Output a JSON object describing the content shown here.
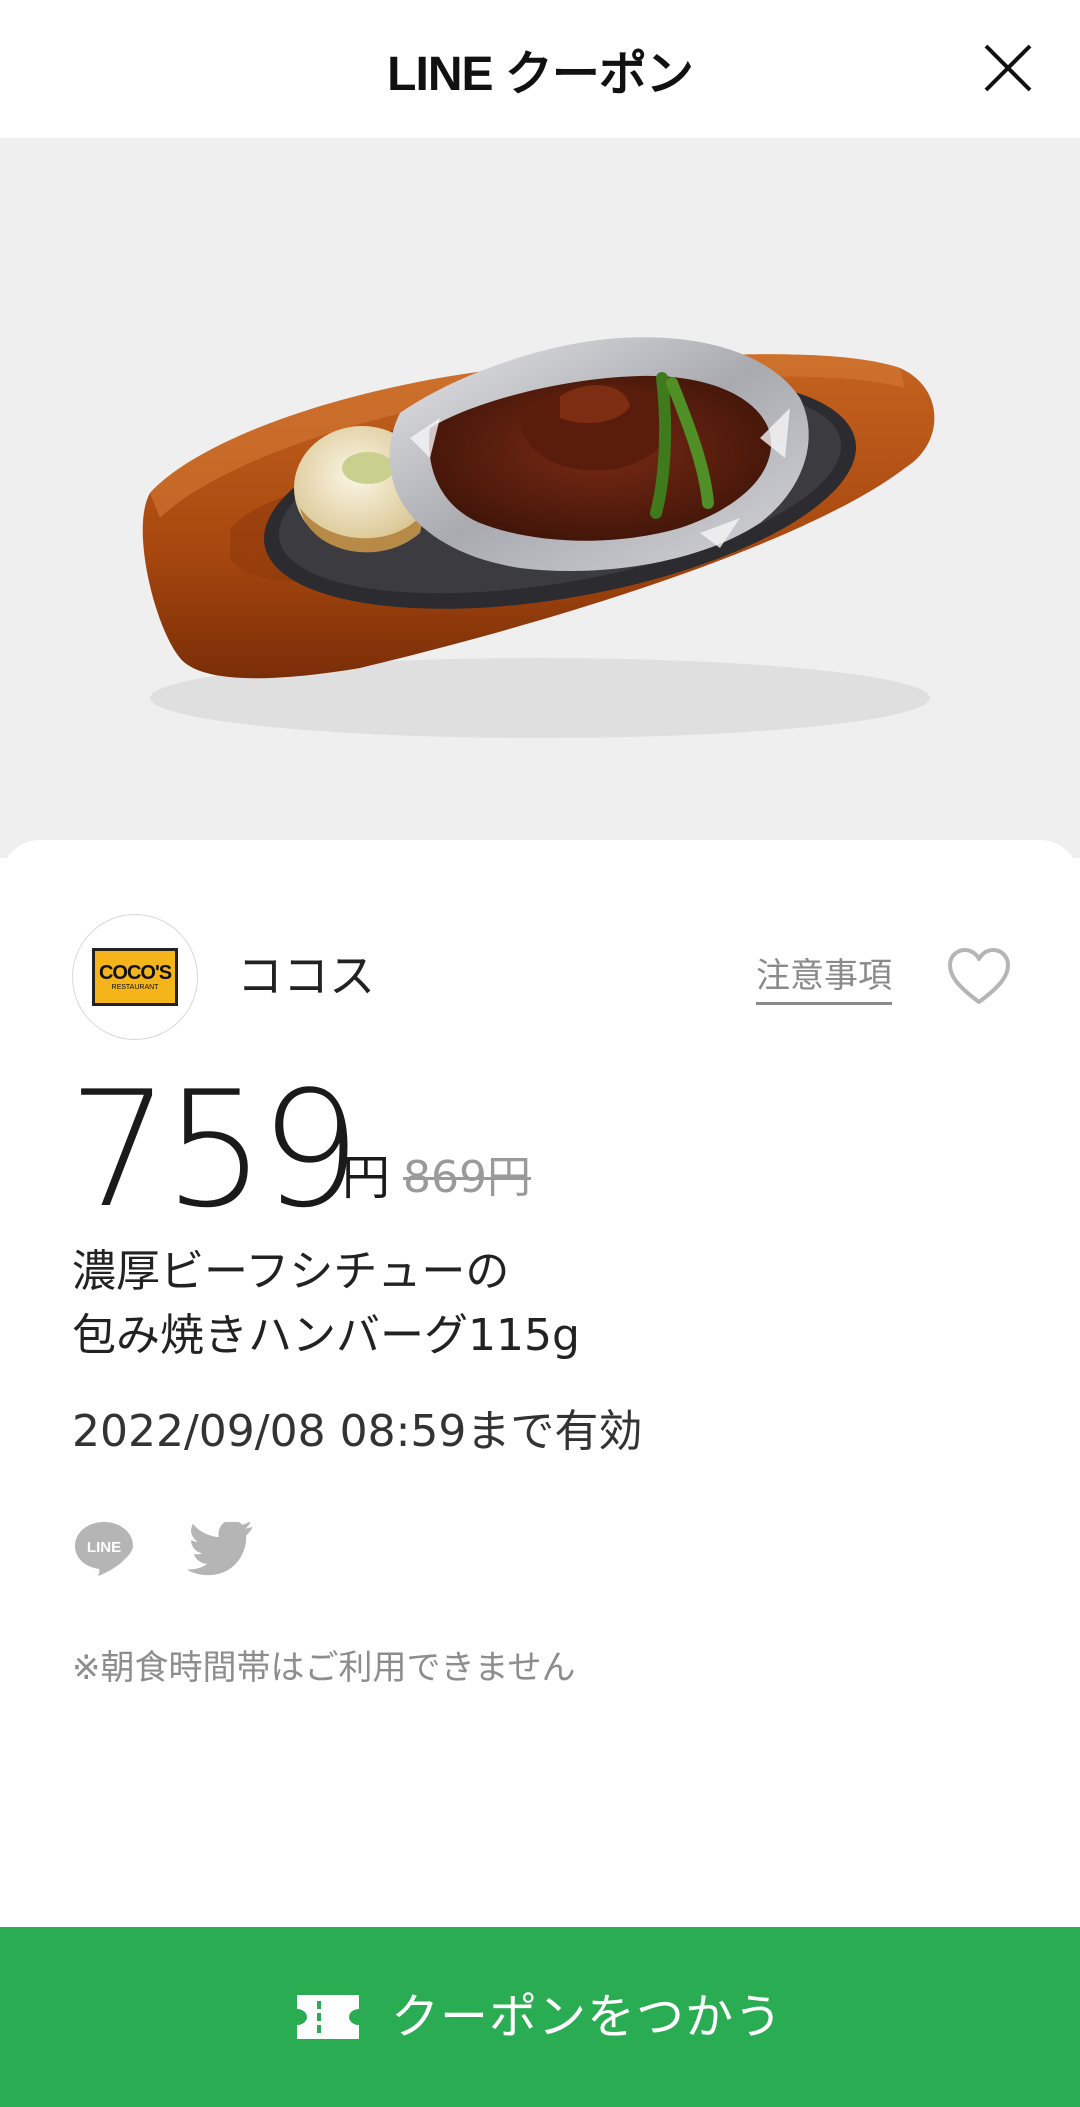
{
  "header": {
    "title": "LINE クーポン"
  },
  "coupon": {
    "store_name": "ココス",
    "logo_text": "COCO'S",
    "logo_subtext": "RESTAURANT",
    "notice_label": "注意事項",
    "price": "759",
    "price_unit": "円",
    "original_price": "869円",
    "title_line1": "濃厚ビーフシチューの",
    "title_line2": "包み焼きハンバーグ115g",
    "validity": "2022/09/08 08:59まで有効",
    "note": "※朝食時間帯はご利用できません"
  },
  "cta": {
    "label": "クーポンをつかう"
  },
  "colors": {
    "accent_green": "#2aac52",
    "logo_yellow": "#f4b41a"
  },
  "icons": [
    "close-icon",
    "heart-icon",
    "line-share-icon",
    "twitter-icon",
    "ticket-icon"
  ]
}
